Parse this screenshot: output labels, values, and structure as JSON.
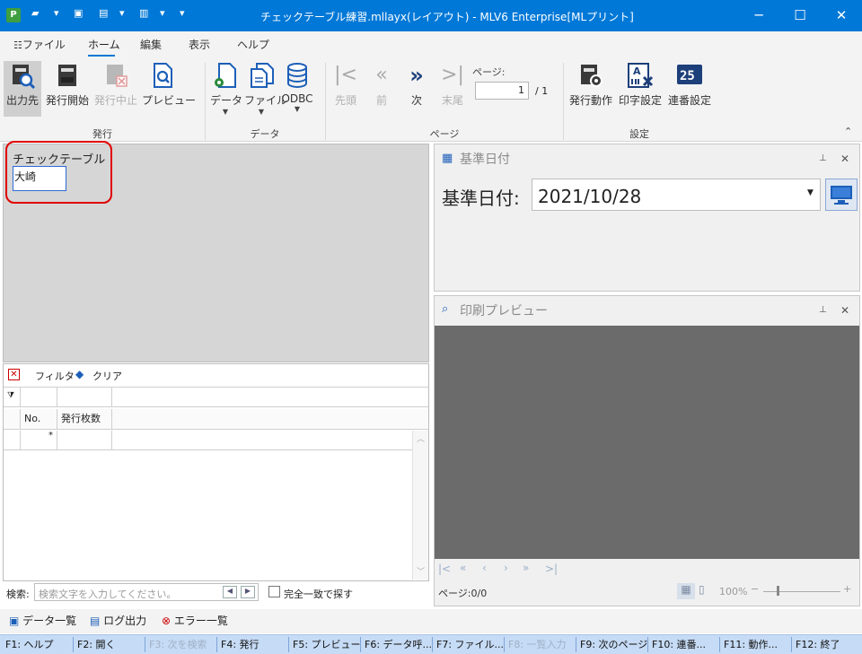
{
  "window": {
    "title": "チェックテーブル練習.mllayx(レイアウト) - MLV6 Enterprise[MLプリント]",
    "minimize": "─",
    "maximize": "☐",
    "close": "✕"
  },
  "menu": {
    "items": [
      "ファイル",
      "ホーム",
      "編集",
      "表示",
      "ヘルプ"
    ]
  },
  "ribbon": {
    "groups": {
      "issue": "発行",
      "data": "データ",
      "page": "ページ",
      "settings": "設定"
    },
    "issue_buttons": [
      "出力先",
      "発行開始",
      "発行中止",
      "プレビュー"
    ],
    "data_buttons": [
      "データ",
      "ファイル",
      "ODBC"
    ],
    "nav_buttons": [
      "先頭",
      "前",
      "次",
      "末尾"
    ],
    "page_label": "ページ:",
    "page_value": "1",
    "page_total": "/ 1",
    "settings_buttons": [
      "発行動作",
      "印字設定",
      "連番設定"
    ]
  },
  "form": {
    "label": "チェックテーブル",
    "value": "大崎"
  },
  "grid": {
    "toolbar": {
      "filter": "フィルタ",
      "clear": "クリア"
    },
    "columns": [
      "No.",
      "発行枚数"
    ],
    "new_row_marker": "*",
    "search_label": "検索:",
    "search_placeholder": "検索文字を入力してください。",
    "exact_match": "完全一致で探す"
  },
  "date_panel": {
    "title": "基準日付",
    "label": "基準日付:",
    "value": "2021/10/28"
  },
  "preview_panel": {
    "title": "印刷プレビュー",
    "page_status": "ページ:0/0",
    "zoom": "100%"
  },
  "bottom_tabs": [
    "データ一覧",
    "ログ出力",
    "エラー一覧"
  ],
  "function_keys": [
    {
      "label": "F1: ヘルプ",
      "enabled": true
    },
    {
      "label": "F2: 開く",
      "enabled": true
    },
    {
      "label": "F3: 次を検索",
      "enabled": false
    },
    {
      "label": "F4: 発行",
      "enabled": true
    },
    {
      "label": "F5: プレビュー",
      "enabled": true
    },
    {
      "label": "F6: データ呼...",
      "enabled": true
    },
    {
      "label": "F7: ファイル...",
      "enabled": true
    },
    {
      "label": "F8: 一覧入力",
      "enabled": false
    },
    {
      "label": "F9: 次のページ",
      "enabled": true
    },
    {
      "label": "F10: 連番...",
      "enabled": true
    },
    {
      "label": "F11: 動作...",
      "enabled": true
    },
    {
      "label": "F12: 終了",
      "enabled": true
    }
  ],
  "colors": {
    "titlebar": "#0078d7",
    "accent": "#0078d7",
    "highlight": "#e00000",
    "statusbar": "#c6dbf5",
    "preview_canvas": "#6b6b6b"
  }
}
